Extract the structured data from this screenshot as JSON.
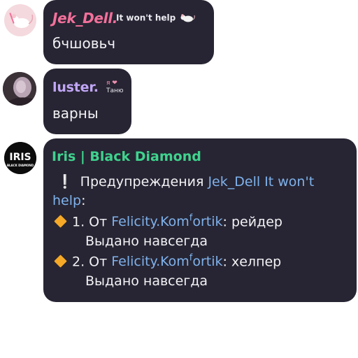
{
  "messages": [
    {
      "author": "Jek_Dell.",
      "status": "It won't help",
      "status_icon": "rat-icon",
      "text": "бчшовьч",
      "name_color": "#f3709b"
    },
    {
      "author": "luster.",
      "status_line1": "я ❤",
      "status_line2": "Таню",
      "text": "варны",
      "name_color": "#c1a6f6"
    },
    {
      "author": "Iris | Black Diamond",
      "name_color": "#3fd38e",
      "avatar_text": "IRIS",
      "avatar_subtext": "BLACK DIAMOND",
      "warnings_prefix": "Предупреждения",
      "warnings_user": "Jek_Dell It won't",
      "warnings_user_cont": "help",
      "warnings_colon": ":",
      "items": [
        {
          "num": "1. От",
          "moderator_a": "Felicity.Kom",
          "moderator_sup": "f",
          "moderator_b": "ortik",
          "reason": ": рейдер",
          "duration": "Выдано навсегда"
        },
        {
          "num": "2. От",
          "moderator_a": "Felicity.Kom",
          "moderator_sup": "f",
          "moderator_b": "ortik",
          "reason": ": хелпер",
          "duration": "Выдано навсегда"
        }
      ]
    }
  ],
  "colors": {
    "bubble": "#272533",
    "link": "#7fb2ec",
    "diamond": "#f6a927"
  }
}
